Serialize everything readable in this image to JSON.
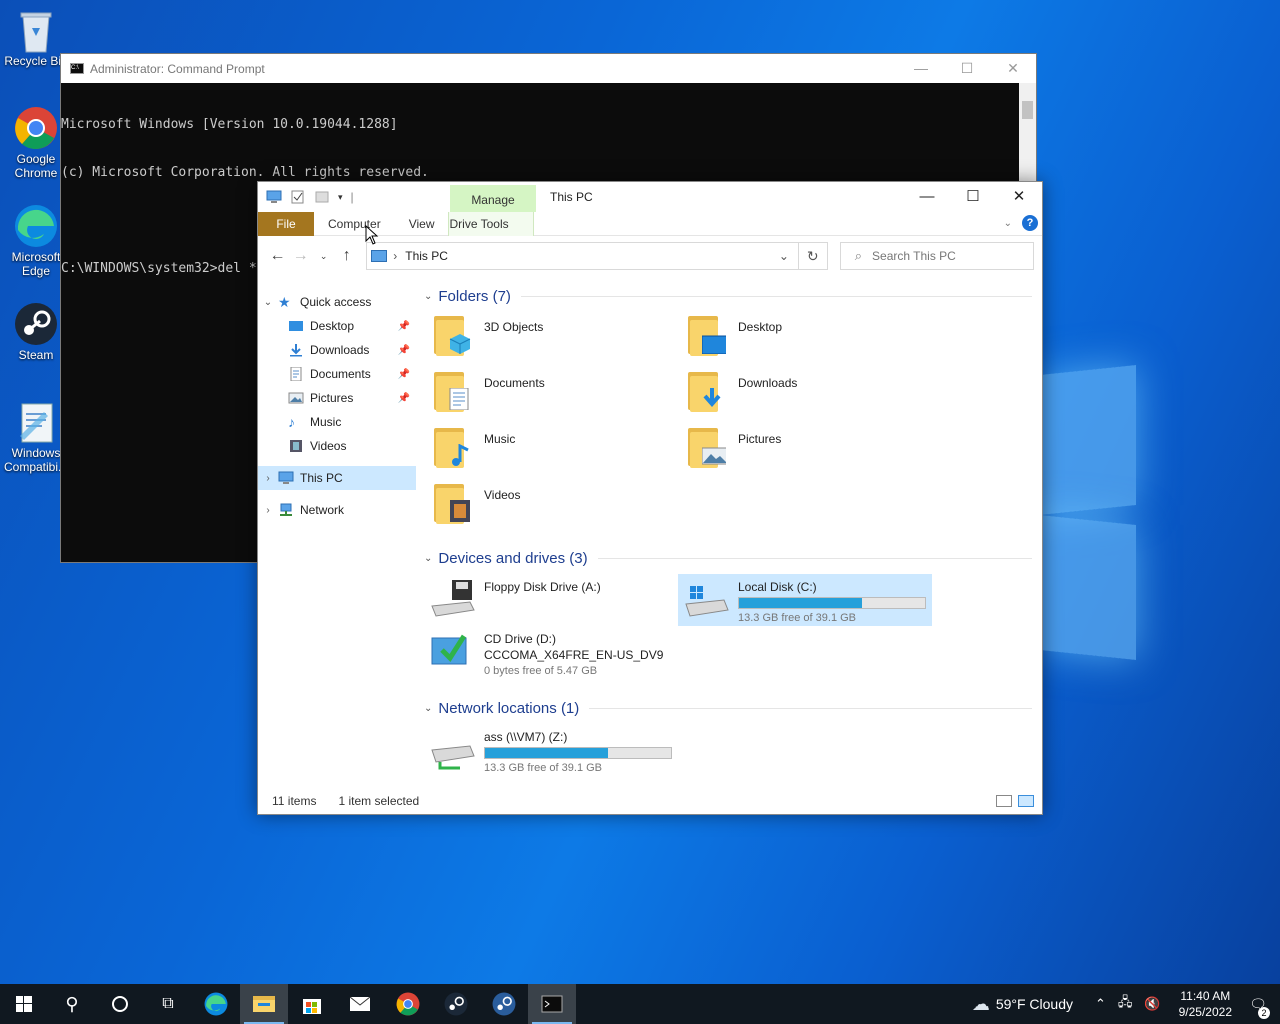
{
  "desktop": {
    "icons": [
      {
        "label": "Recycle Bin",
        "icon": "recycle-bin-icon"
      },
      {
        "label": "Google Chrome",
        "icon": "chrome-icon"
      },
      {
        "label": "Microsoft Edge",
        "icon": "edge-icon"
      },
      {
        "label": "Steam",
        "icon": "steam-icon"
      },
      {
        "label": "Windows Compatibi...",
        "icon": "compatibility-icon"
      }
    ]
  },
  "cmd": {
    "title": "Administrator: Command Prompt",
    "lines": [
      "Microsoft Windows [Version 10.0.19044.1288]",
      "(c) Microsoft Corporation. All rights reserved.",
      "",
      "C:\\WINDOWS\\system32>del *."
    ],
    "controls": {
      "minimize": "—",
      "maximize": "☐",
      "close": "✕"
    }
  },
  "explorer": {
    "title": "This PC",
    "manage_tab": "Manage",
    "ribbon_tabs": {
      "file": "File",
      "computer": "Computer",
      "view": "View",
      "drive_tools": "Drive Tools"
    },
    "controls": {
      "minimize": "—",
      "maximize": "☐",
      "close": "✕"
    },
    "address": {
      "crumb": "This PC"
    },
    "search": {
      "placeholder": "Search This PC"
    },
    "nav": {
      "quick_access": "Quick access",
      "items": [
        "Desktop",
        "Downloads",
        "Documents",
        "Pictures",
        "Music",
        "Videos"
      ],
      "this_pc": "This PC",
      "network": "Network"
    },
    "groups": {
      "folders": "Folders (7)",
      "devices": "Devices and drives (3)",
      "network": "Network locations (1)"
    },
    "folders": [
      {
        "name": "3D Objects",
        "badge": "cube-icon"
      },
      {
        "name": "Desktop",
        "badge": "desktop-screen-icon"
      },
      {
        "name": "Documents",
        "badge": "document-icon"
      },
      {
        "name": "Downloads",
        "badge": "download-arrow-icon"
      },
      {
        "name": "Music",
        "badge": "music-note-icon"
      },
      {
        "name": "Pictures",
        "badge": "picture-icon"
      },
      {
        "name": "Videos",
        "badge": "film-icon"
      }
    ],
    "drives": {
      "floppy": {
        "name": "Floppy Disk Drive (A:)"
      },
      "local_c": {
        "name": "Local Disk (C:)",
        "free": "13.3 GB free of 39.1 GB",
        "used_fraction": 0.66
      },
      "cd": {
        "name": "CD Drive (D:)",
        "label": "CCCOMA_X64FRE_EN-US_DV9",
        "free": "0 bytes free of 5.47 GB"
      },
      "network_z": {
        "name": "ass (\\\\VM7) (Z:)",
        "free": "13.3 GB free of 39.1 GB",
        "used_fraction": 0.66
      }
    },
    "status": {
      "items": "11 items",
      "selected": "1 item selected"
    }
  },
  "taskbar": {
    "weather": "59°F  Cloudy",
    "time": "11:40 AM",
    "date": "9/25/2022",
    "notifications": "2"
  },
  "colors": {
    "accent": "#26a0da",
    "file_tab": "#a4761f",
    "manage_tab": "#d5f5c4",
    "selection": "#cce8ff"
  }
}
